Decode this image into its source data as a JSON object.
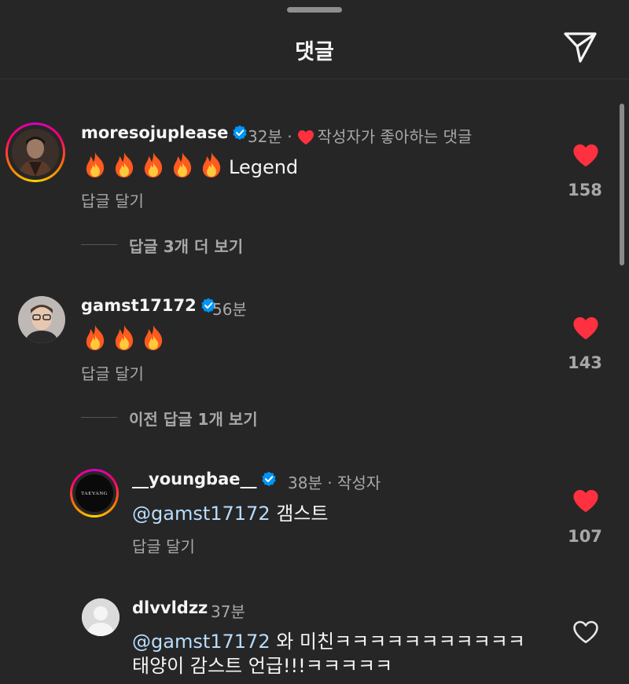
{
  "header": {
    "title": "댓글",
    "send_icon": "paper-plane-icon"
  },
  "comments": [
    {
      "username": "moresojuplease",
      "time": "32분",
      "separator": "·",
      "creator_liked": "작성자가 좋아하는 댓글",
      "text": "Legend",
      "fire_count": 5,
      "reply_label": "답글 달기",
      "likes": "158",
      "view_replies": "답글 3개 더 보기"
    },
    {
      "username": "gamst17172",
      "time": "56분",
      "fire_count": 3,
      "reply_label": "답글 달기",
      "likes": "143",
      "view_replies": "이전 답글 1개 보기"
    },
    {
      "username": "__youngbae__",
      "time": "38분 · 작성자",
      "mention": "@gamst17172",
      "text": " 갬스트",
      "reply_label": "답글 달기",
      "likes": "107",
      "avatar_text": "TAEYANG"
    },
    {
      "username": "dlvvldzz",
      "time": "37분",
      "mention": "@gamst17172",
      "text_line1": " 와 미친ㅋㅋㅋㅋㅋㅋㅋㅋㅋㅋㅋ",
      "text_line2": "태양이 감스트 언급!!!ㅋㅋㅋㅋㅋ"
    }
  ],
  "colors": {
    "background": "#262626",
    "like_red": "#ff3040",
    "verified_blue": "#0095f6",
    "mention": "#b8ddff"
  }
}
